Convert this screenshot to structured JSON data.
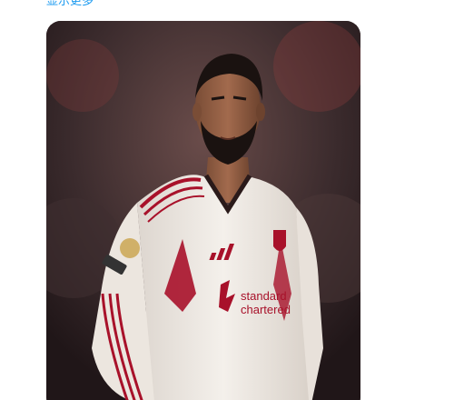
{
  "tweet": {
    "show_more_label": "显示更多"
  },
  "media": {
    "subject": "player-photo",
    "sponsor_text_line1": "standard",
    "sponsor_text_line2": "chartered"
  },
  "colors": {
    "link": "#1d9bf0",
    "shirt": "#f1ece6",
    "shirt_trim": "#a8112a",
    "background_dark": "#2b1f22"
  }
}
